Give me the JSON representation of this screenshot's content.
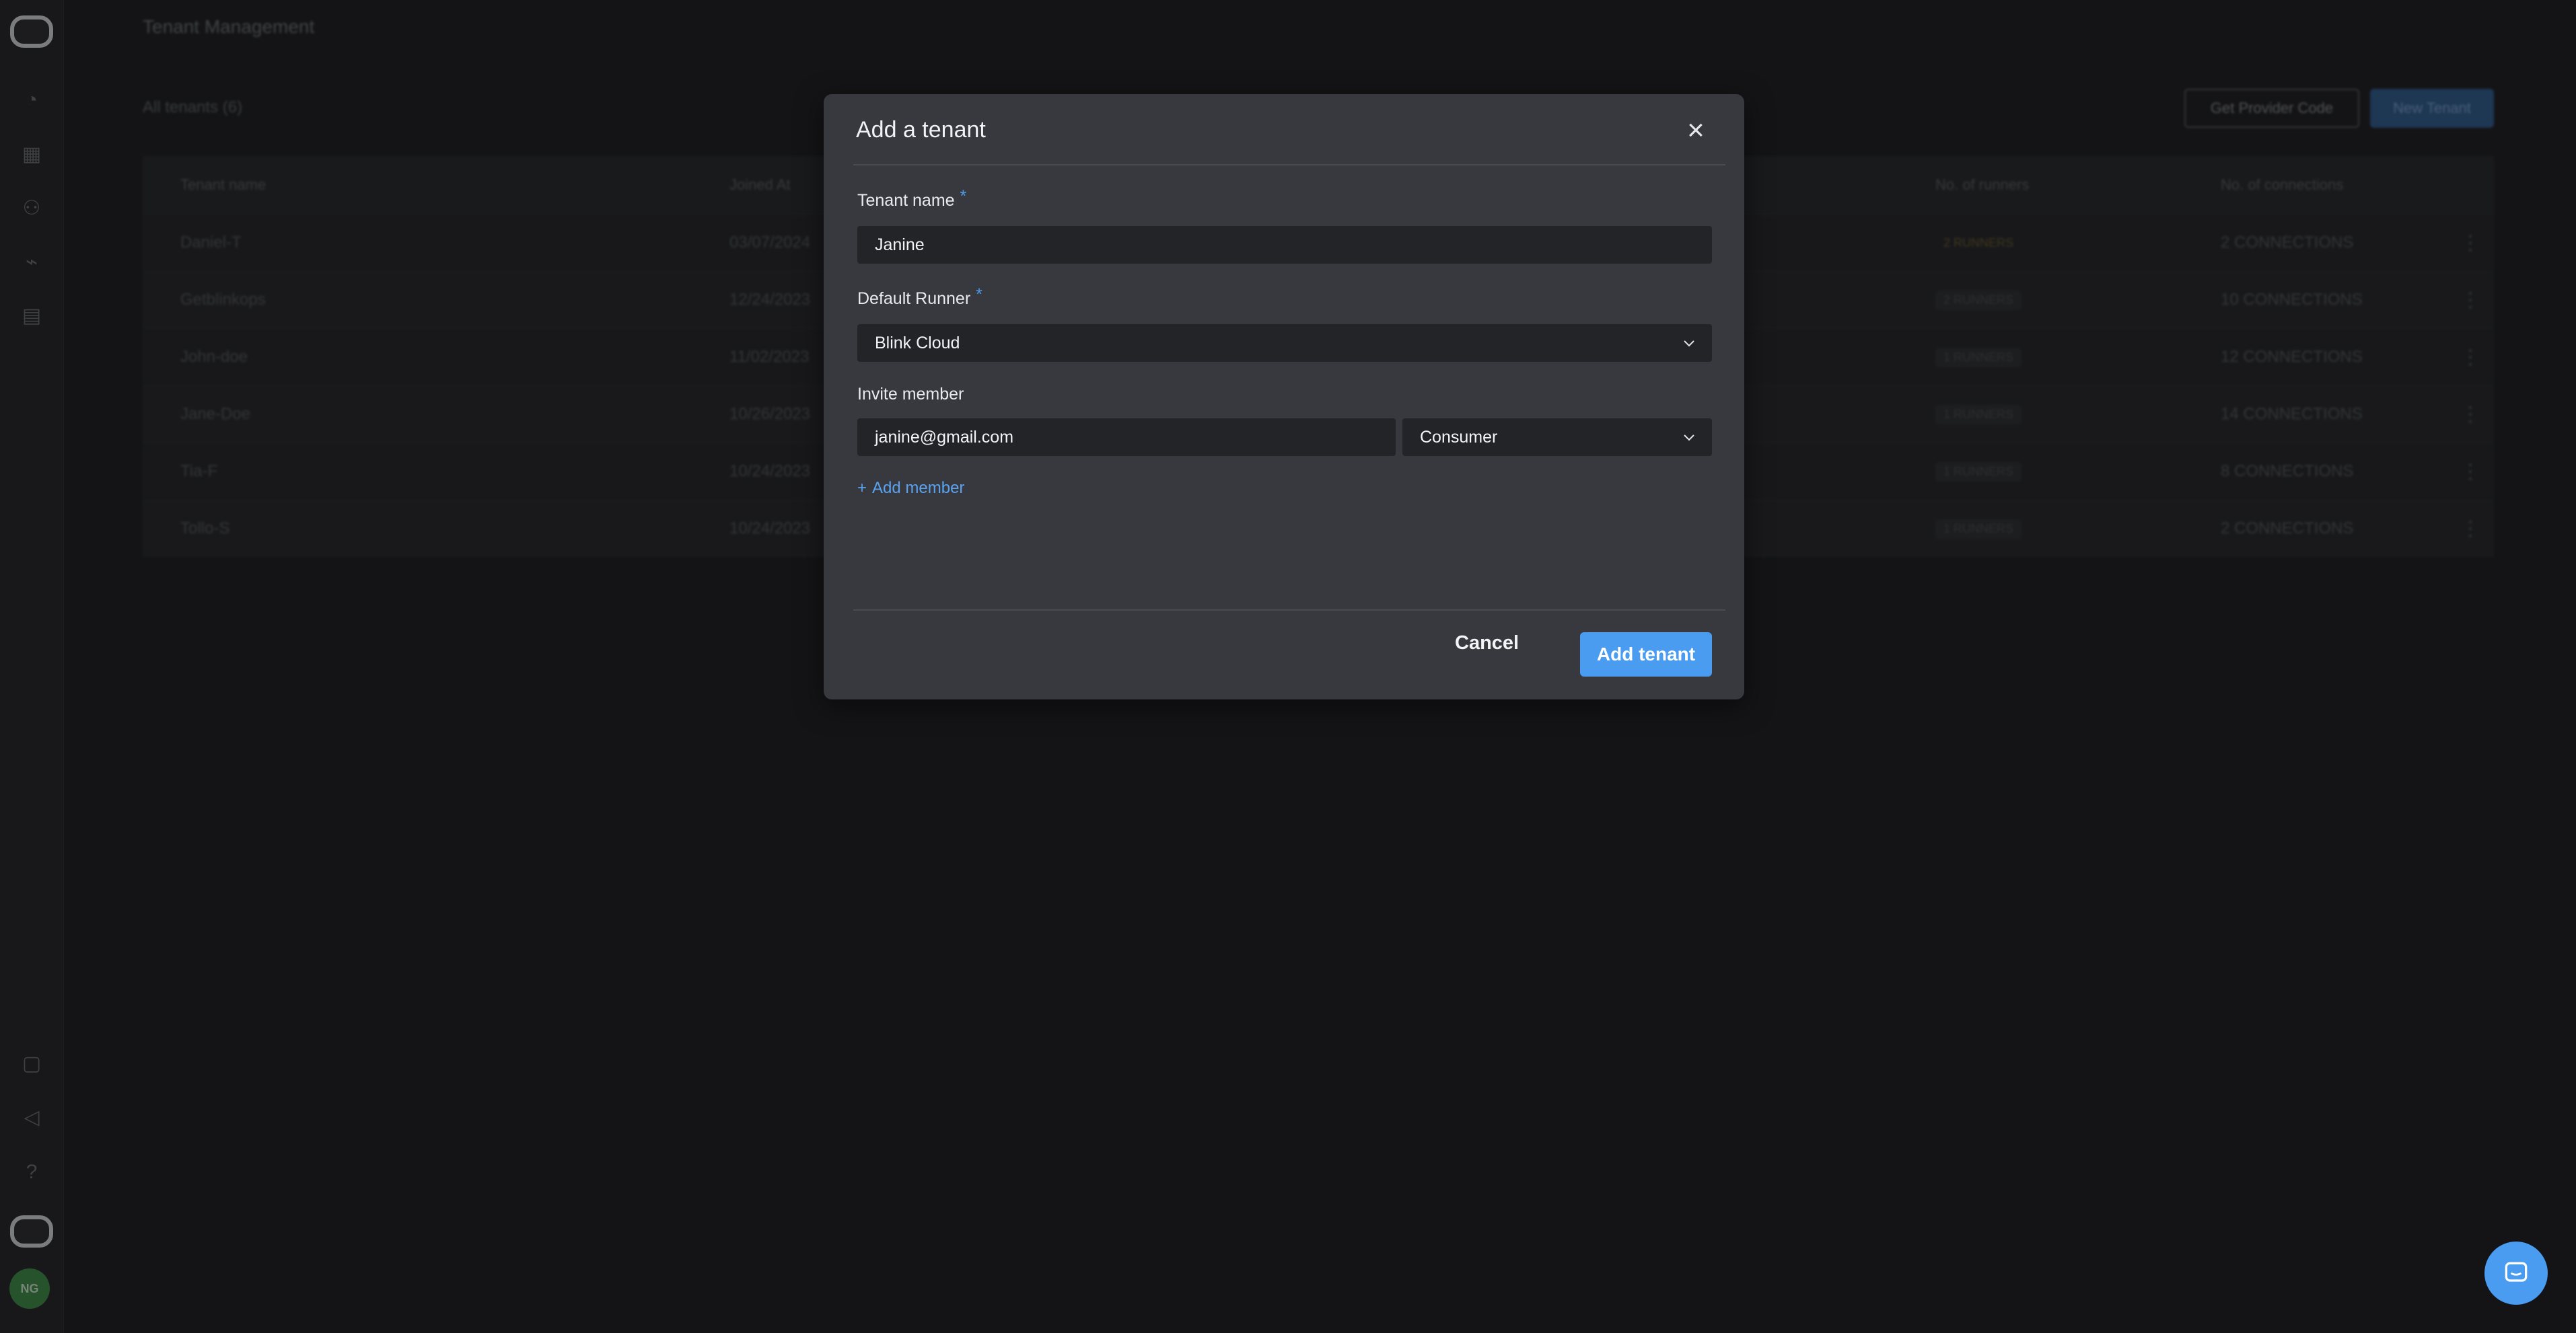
{
  "sidebar": {
    "icons": [
      "logo-icon",
      "dashboard-icon",
      "grid-icon",
      "users-icon",
      "chart-icon",
      "clipboard-icon",
      "box-icon",
      "megaphone-icon",
      "help-icon",
      "brand-icon"
    ],
    "avatar_initials": "NG"
  },
  "page": {
    "title": "Tenant Management",
    "all_count": "All tenants (6)",
    "get_provider_code": "Get Provider Code",
    "new_tenant": "New Tenant"
  },
  "table": {
    "headers": {
      "name": "Tenant name",
      "joined": "Joined At",
      "runners": "No. of runners",
      "connections": "No. of connections"
    },
    "rows": [
      {
        "name": "Daniel-T",
        "joined": "03/07/2024",
        "runners": "2 RUNNERS",
        "connections": "2 CONNECTIONS",
        "warning": true
      },
      {
        "name": "Getblinkops",
        "joined": "12/24/2023",
        "runners": "2 RUNNERS",
        "connections": "10 CONNECTIONS",
        "warning": false
      },
      {
        "name": "John-doe",
        "joined": "11/02/2023",
        "runners": "1 RUNNERS",
        "connections": "12 CONNECTIONS",
        "warning": false
      },
      {
        "name": "Jane-Doe",
        "joined": "10/26/2023",
        "runners": "1 RUNNERS",
        "connections": "14 CONNECTIONS",
        "warning": false
      },
      {
        "name": "Tia-F",
        "joined": "10/24/2023",
        "runners": "1 RUNNERS",
        "connections": "8 CONNECTIONS",
        "warning": false
      },
      {
        "name": "Tollo-S",
        "joined": "10/24/2023",
        "runners": "1 RUNNERS",
        "connections": "2 CONNECTIONS",
        "warning": false
      }
    ]
  },
  "modal": {
    "title": "Add a tenant",
    "tenant_name_label": "Tenant name",
    "tenant_name_value": "Janine",
    "default_runner_label": "Default Runner",
    "default_runner_value": "Blink Cloud",
    "invite_member_label": "Invite member",
    "invite_email_value": "janine@gmail.com",
    "invite_role_value": "Consumer",
    "add_member_label": "Add member",
    "required_mark": "*",
    "cancel_label": "Cancel",
    "submit_label": "Add tenant"
  },
  "colors": {
    "accent": "#4a9cf0",
    "modal_bg": "#38393e",
    "page_bg": "#1c1d20"
  }
}
